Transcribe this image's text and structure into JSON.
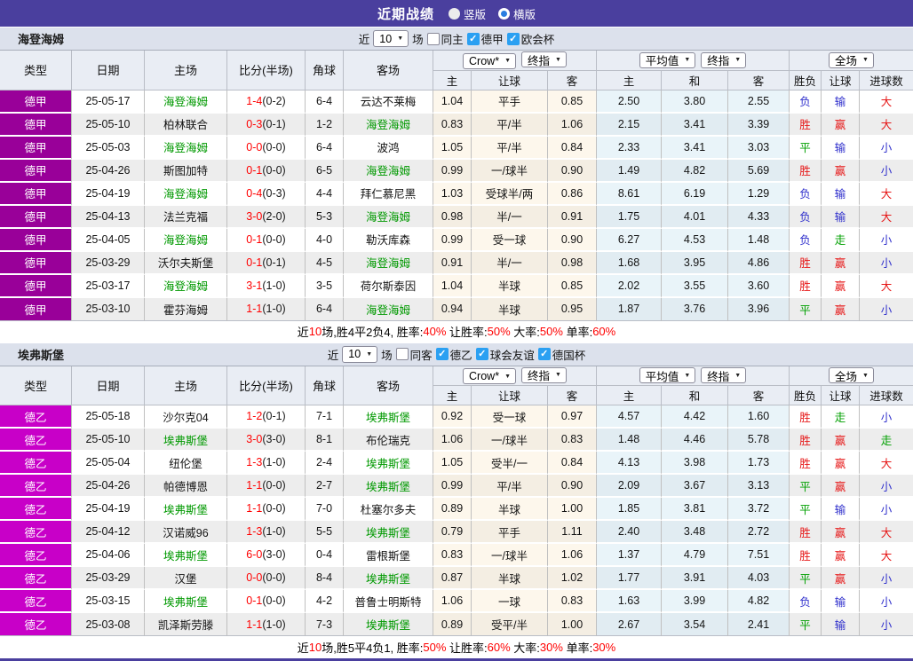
{
  "titlebar": {
    "title": "近期战绩",
    "layout_options": [
      {
        "label": "竖版",
        "selected": false
      },
      {
        "label": "横版",
        "selected": true
      }
    ]
  },
  "table_headers": {
    "left": [
      "类型",
      "日期",
      "主场",
      "比分(半场)",
      "角球",
      "客场"
    ],
    "odds_dropdowns": [
      "Crow*",
      "终指"
    ],
    "avg_dropdowns": [
      "平均值",
      "终指"
    ],
    "result_dropdown": "全场",
    "odds_sub": [
      "主",
      "让球",
      "客"
    ],
    "avg_sub": [
      "主",
      "和",
      "客"
    ],
    "result_sub": [
      "胜负",
      "让球",
      "进球数"
    ]
  },
  "sections": [
    {
      "team": "海登海姆",
      "type_color": "#990099",
      "filter": {
        "prefix": "近",
        "count": "10",
        "suffix": "场",
        "same_checkbox": {
          "label": "同主",
          "checked": false
        },
        "league_checkboxes": [
          {
            "label": "德甲",
            "checked": true
          },
          {
            "label": "欧会杯",
            "checked": true
          }
        ]
      },
      "rows": [
        {
          "league": "德甲",
          "date": "25-05-17",
          "home": "海登海姆",
          "home_is_team": true,
          "score_ft": "1-4",
          "score_ht": "(0-2)",
          "corner": "6-4",
          "away": "云达不莱梅",
          "away_is_team": false,
          "odds": [
            "1.04",
            "平手",
            "0.85"
          ],
          "avg": [
            "2.50",
            "3.80",
            "2.55"
          ],
          "results": [
            {
              "text": "负",
              "color": "blue"
            },
            {
              "text": "输",
              "color": "blue"
            },
            {
              "text": "大",
              "color": "red"
            }
          ]
        },
        {
          "league": "德甲",
          "date": "25-05-10",
          "home": "柏林联合",
          "home_is_team": false,
          "score_ft": "0-3",
          "score_ht": "(0-1)",
          "corner": "1-2",
          "away": "海登海姆",
          "away_is_team": true,
          "odds": [
            "0.83",
            "平/半",
            "1.06"
          ],
          "avg": [
            "2.15",
            "3.41",
            "3.39"
          ],
          "results": [
            {
              "text": "胜",
              "color": "red"
            },
            {
              "text": "赢",
              "color": "red"
            },
            {
              "text": "大",
              "color": "red"
            }
          ]
        },
        {
          "league": "德甲",
          "date": "25-05-03",
          "home": "海登海姆",
          "home_is_team": true,
          "score_ft": "0-0",
          "score_ht": "(0-0)",
          "corner": "6-4",
          "away": "波鸿",
          "away_is_team": false,
          "odds": [
            "1.05",
            "平/半",
            "0.84"
          ],
          "avg": [
            "2.33",
            "3.41",
            "3.03"
          ],
          "results": [
            {
              "text": "平",
              "color": "green"
            },
            {
              "text": "输",
              "color": "blue"
            },
            {
              "text": "小",
              "color": "blue"
            }
          ]
        },
        {
          "league": "德甲",
          "date": "25-04-26",
          "home": "斯图加特",
          "home_is_team": false,
          "score_ft": "0-1",
          "score_ht": "(0-0)",
          "corner": "6-5",
          "away": "海登海姆",
          "away_is_team": true,
          "odds": [
            "0.99",
            "一/球半",
            "0.90"
          ],
          "avg": [
            "1.49",
            "4.82",
            "5.69"
          ],
          "results": [
            {
              "text": "胜",
              "color": "red"
            },
            {
              "text": "赢",
              "color": "red"
            },
            {
              "text": "小",
              "color": "blue"
            }
          ]
        },
        {
          "league": "德甲",
          "date": "25-04-19",
          "home": "海登海姆",
          "home_is_team": true,
          "score_ft": "0-4",
          "score_ht": "(0-3)",
          "corner": "4-4",
          "away": "拜仁慕尼黑",
          "away_is_team": false,
          "odds": [
            "1.03",
            "受球半/两",
            "0.86"
          ],
          "avg": [
            "8.61",
            "6.19",
            "1.29"
          ],
          "results": [
            {
              "text": "负",
              "color": "blue"
            },
            {
              "text": "输",
              "color": "blue"
            },
            {
              "text": "大",
              "color": "red"
            }
          ]
        },
        {
          "league": "德甲",
          "date": "25-04-13",
          "home": "法兰克福",
          "home_is_team": false,
          "score_ft": "3-0",
          "score_ht": "(2-0)",
          "corner": "5-3",
          "away": "海登海姆",
          "away_is_team": true,
          "odds": [
            "0.98",
            "半/一",
            "0.91"
          ],
          "avg": [
            "1.75",
            "4.01",
            "4.33"
          ],
          "results": [
            {
              "text": "负",
              "color": "blue"
            },
            {
              "text": "输",
              "color": "blue"
            },
            {
              "text": "大",
              "color": "red"
            }
          ]
        },
        {
          "league": "德甲",
          "date": "25-04-05",
          "home": "海登海姆",
          "home_is_team": true,
          "score_ft": "0-1",
          "score_ht": "(0-0)",
          "corner": "4-0",
          "away": "勒沃库森",
          "away_is_team": false,
          "odds": [
            "0.99",
            "受一球",
            "0.90"
          ],
          "avg": [
            "6.27",
            "4.53",
            "1.48"
          ],
          "results": [
            {
              "text": "负",
              "color": "blue"
            },
            {
              "text": "走",
              "color": "green"
            },
            {
              "text": "小",
              "color": "blue"
            }
          ]
        },
        {
          "league": "德甲",
          "date": "25-03-29",
          "home": "沃尔夫斯堡",
          "home_is_team": false,
          "score_ft": "0-1",
          "score_ht": "(0-1)",
          "corner": "4-5",
          "away": "海登海姆",
          "away_is_team": true,
          "odds": [
            "0.91",
            "半/一",
            "0.98"
          ],
          "avg": [
            "1.68",
            "3.95",
            "4.86"
          ],
          "results": [
            {
              "text": "胜",
              "color": "red"
            },
            {
              "text": "赢",
              "color": "red"
            },
            {
              "text": "小",
              "color": "blue"
            }
          ]
        },
        {
          "league": "德甲",
          "date": "25-03-17",
          "home": "海登海姆",
          "home_is_team": true,
          "score_ft": "3-1",
          "score_ht": "(1-0)",
          "corner": "3-5",
          "away": "荷尔斯泰因",
          "away_is_team": false,
          "odds": [
            "1.04",
            "半球",
            "0.85"
          ],
          "avg": [
            "2.02",
            "3.55",
            "3.60"
          ],
          "results": [
            {
              "text": "胜",
              "color": "red"
            },
            {
              "text": "赢",
              "color": "red"
            },
            {
              "text": "大",
              "color": "red"
            }
          ]
        },
        {
          "league": "德甲",
          "date": "25-03-10",
          "home": "霍芬海姆",
          "home_is_team": false,
          "score_ft": "1-1",
          "score_ht": "(1-0)",
          "corner": "6-4",
          "away": "海登海姆",
          "away_is_team": true,
          "odds": [
            "0.94",
            "半球",
            "0.95"
          ],
          "avg": [
            "1.87",
            "3.76",
            "3.96"
          ],
          "results": [
            {
              "text": "平",
              "color": "green"
            },
            {
              "text": "赢",
              "color": "red"
            },
            {
              "text": "小",
              "color": "blue"
            }
          ]
        }
      ],
      "summary": [
        {
          "text": "近",
          "red": false
        },
        {
          "text": "10",
          "red": true
        },
        {
          "text": "场,胜4平2负4, 胜率:",
          "red": false
        },
        {
          "text": "40%",
          "red": true
        },
        {
          "text": " 让胜率:",
          "red": false
        },
        {
          "text": "50%",
          "red": true
        },
        {
          "text": " 大率:",
          "red": false
        },
        {
          "text": "50%",
          "red": true
        },
        {
          "text": " 单率:",
          "red": false
        },
        {
          "text": "60%",
          "red": true
        }
      ]
    },
    {
      "team": "埃弗斯堡",
      "type_color": "#c800c8",
      "filter": {
        "prefix": "近",
        "count": "10",
        "suffix": "场",
        "same_checkbox": {
          "label": "同客",
          "checked": false
        },
        "league_checkboxes": [
          {
            "label": "德乙",
            "checked": true
          },
          {
            "label": "球会友谊",
            "checked": true
          },
          {
            "label": "德国杯",
            "checked": true
          }
        ]
      },
      "rows": [
        {
          "league": "德乙",
          "date": "25-05-18",
          "home": "沙尔克04",
          "home_is_team": false,
          "score_ft": "1-2",
          "score_ht": "(0-1)",
          "corner": "7-1",
          "away": "埃弗斯堡",
          "away_is_team": true,
          "odds": [
            "0.92",
            "受一球",
            "0.97"
          ],
          "avg": [
            "4.57",
            "4.42",
            "1.60"
          ],
          "results": [
            {
              "text": "胜",
              "color": "red"
            },
            {
              "text": "走",
              "color": "green"
            },
            {
              "text": "小",
              "color": "blue"
            }
          ]
        },
        {
          "league": "德乙",
          "date": "25-05-10",
          "home": "埃弗斯堡",
          "home_is_team": true,
          "score_ft": "3-0",
          "score_ht": "(3-0)",
          "corner": "8-1",
          "away": "布伦瑞克",
          "away_is_team": false,
          "odds": [
            "1.06",
            "一/球半",
            "0.83"
          ],
          "avg": [
            "1.48",
            "4.46",
            "5.78"
          ],
          "results": [
            {
              "text": "胜",
              "color": "red"
            },
            {
              "text": "赢",
              "color": "red"
            },
            {
              "text": "走",
              "color": "green"
            }
          ]
        },
        {
          "league": "德乙",
          "date": "25-05-04",
          "home": "纽伦堡",
          "home_is_team": false,
          "score_ft": "1-3",
          "score_ht": "(1-0)",
          "corner": "2-4",
          "away": "埃弗斯堡",
          "away_is_team": true,
          "odds": [
            "1.05",
            "受半/一",
            "0.84"
          ],
          "avg": [
            "4.13",
            "3.98",
            "1.73"
          ],
          "results": [
            {
              "text": "胜",
              "color": "red"
            },
            {
              "text": "赢",
              "color": "red"
            },
            {
              "text": "大",
              "color": "red"
            }
          ]
        },
        {
          "league": "德乙",
          "date": "25-04-26",
          "home": "帕德博恩",
          "home_is_team": false,
          "score_ft": "1-1",
          "score_ht": "(0-0)",
          "corner": "2-7",
          "away": "埃弗斯堡",
          "away_is_team": true,
          "odds": [
            "0.99",
            "平/半",
            "0.90"
          ],
          "avg": [
            "2.09",
            "3.67",
            "3.13"
          ],
          "results": [
            {
              "text": "平",
              "color": "green"
            },
            {
              "text": "赢",
              "color": "red"
            },
            {
              "text": "小",
              "color": "blue"
            }
          ]
        },
        {
          "league": "德乙",
          "date": "25-04-19",
          "home": "埃弗斯堡",
          "home_is_team": true,
          "score_ft": "1-1",
          "score_ht": "(0-0)",
          "corner": "7-0",
          "away": "杜塞尔多夫",
          "away_is_team": false,
          "odds": [
            "0.89",
            "半球",
            "1.00"
          ],
          "avg": [
            "1.85",
            "3.81",
            "3.72"
          ],
          "results": [
            {
              "text": "平",
              "color": "green"
            },
            {
              "text": "输",
              "color": "blue"
            },
            {
              "text": "小",
              "color": "blue"
            }
          ]
        },
        {
          "league": "德乙",
          "date": "25-04-12",
          "home": "汉诺威96",
          "home_is_team": false,
          "score_ft": "1-3",
          "score_ht": "(1-0)",
          "corner": "5-5",
          "away": "埃弗斯堡",
          "away_is_team": true,
          "odds": [
            "0.79",
            "平手",
            "1.11"
          ],
          "avg": [
            "2.40",
            "3.48",
            "2.72"
          ],
          "results": [
            {
              "text": "胜",
              "color": "red"
            },
            {
              "text": "赢",
              "color": "red"
            },
            {
              "text": "大",
              "color": "red"
            }
          ]
        },
        {
          "league": "德乙",
          "date": "25-04-06",
          "home": "埃弗斯堡",
          "home_is_team": true,
          "score_ft": "6-0",
          "score_ht": "(3-0)",
          "corner": "0-4",
          "away": "雷根斯堡",
          "away_is_team": false,
          "odds": [
            "0.83",
            "一/球半",
            "1.06"
          ],
          "avg": [
            "1.37",
            "4.79",
            "7.51"
          ],
          "results": [
            {
              "text": "胜",
              "color": "red"
            },
            {
              "text": "赢",
              "color": "red"
            },
            {
              "text": "大",
              "color": "red"
            }
          ]
        },
        {
          "league": "德乙",
          "date": "25-03-29",
          "home": "汉堡",
          "home_is_team": false,
          "score_ft": "0-0",
          "score_ht": "(0-0)",
          "corner": "8-4",
          "away": "埃弗斯堡",
          "away_is_team": true,
          "odds": [
            "0.87",
            "半球",
            "1.02"
          ],
          "avg": [
            "1.77",
            "3.91",
            "4.03"
          ],
          "results": [
            {
              "text": "平",
              "color": "green"
            },
            {
              "text": "赢",
              "color": "red"
            },
            {
              "text": "小",
              "color": "blue"
            }
          ]
        },
        {
          "league": "德乙",
          "date": "25-03-15",
          "home": "埃弗斯堡",
          "home_is_team": true,
          "score_ft": "0-1",
          "score_ht": "(0-0)",
          "corner": "4-2",
          "away": "普鲁士明斯特",
          "away_is_team": false,
          "odds": [
            "1.06",
            "一球",
            "0.83"
          ],
          "avg": [
            "1.63",
            "3.99",
            "4.82"
          ],
          "results": [
            {
              "text": "负",
              "color": "blue"
            },
            {
              "text": "输",
              "color": "blue"
            },
            {
              "text": "小",
              "color": "blue"
            }
          ]
        },
        {
          "league": "德乙",
          "date": "25-03-08",
          "home": "凯泽斯劳滕",
          "home_is_team": false,
          "score_ft": "1-1",
          "score_ht": "(1-0)",
          "corner": "7-3",
          "away": "埃弗斯堡",
          "away_is_team": true,
          "odds": [
            "0.89",
            "受平/半",
            "1.00"
          ],
          "avg": [
            "2.67",
            "3.54",
            "2.41"
          ],
          "results": [
            {
              "text": "平",
              "color": "green"
            },
            {
              "text": "输",
              "color": "blue"
            },
            {
              "text": "小",
              "color": "blue"
            }
          ]
        }
      ],
      "summary": [
        {
          "text": "近",
          "red": false
        },
        {
          "text": "10",
          "red": true
        },
        {
          "text": "场,胜5平4负1, 胜率:",
          "red": false
        },
        {
          "text": "50%",
          "red": true
        },
        {
          "text": " 让胜率:",
          "red": false
        },
        {
          "text": "60%",
          "red": true
        },
        {
          "text": " 大率:",
          "red": false
        },
        {
          "text": "30%",
          "red": true
        },
        {
          "text": " 单率:",
          "red": false
        },
        {
          "text": "30%",
          "red": true
        }
      ]
    }
  ]
}
